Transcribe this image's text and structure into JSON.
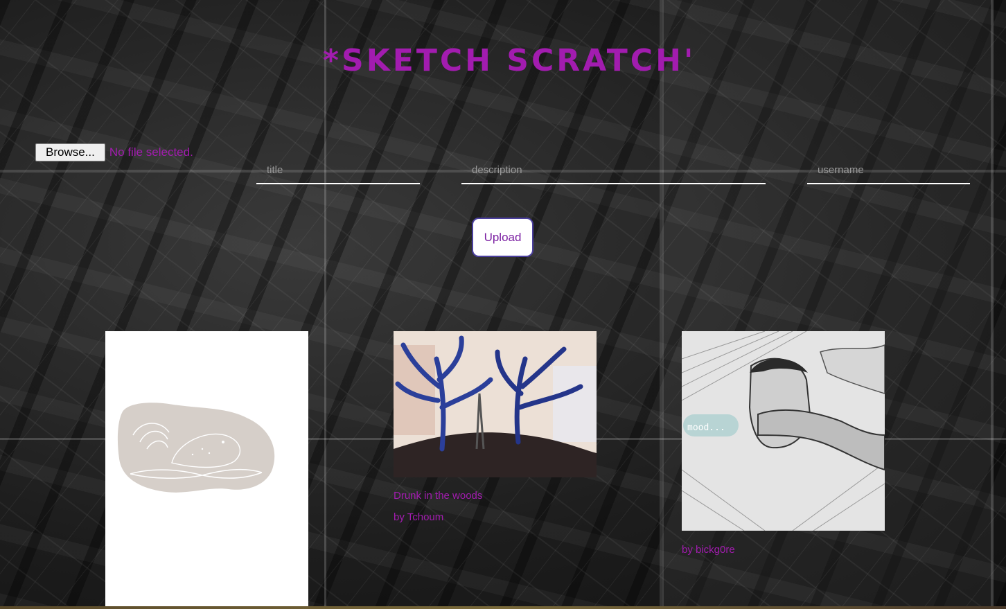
{
  "app": {
    "title": "*Sketch Scratch'"
  },
  "upload_form": {
    "browse_label": "Browse...",
    "file_status": "No file selected.",
    "title_placeholder": "title",
    "description_placeholder": "description",
    "username_placeholder": "username",
    "upload_label": "Upload"
  },
  "gallery": {
    "items": [
      {
        "title": "",
        "author": ""
      },
      {
        "title": "Drunk in the woods",
        "author": "by Tchoum"
      },
      {
        "title": "",
        "author": "by bickg0re"
      }
    ]
  },
  "colors": {
    "accent": "#a21caf",
    "button_border": "#4b3f9e",
    "underline": "#ffffff"
  }
}
